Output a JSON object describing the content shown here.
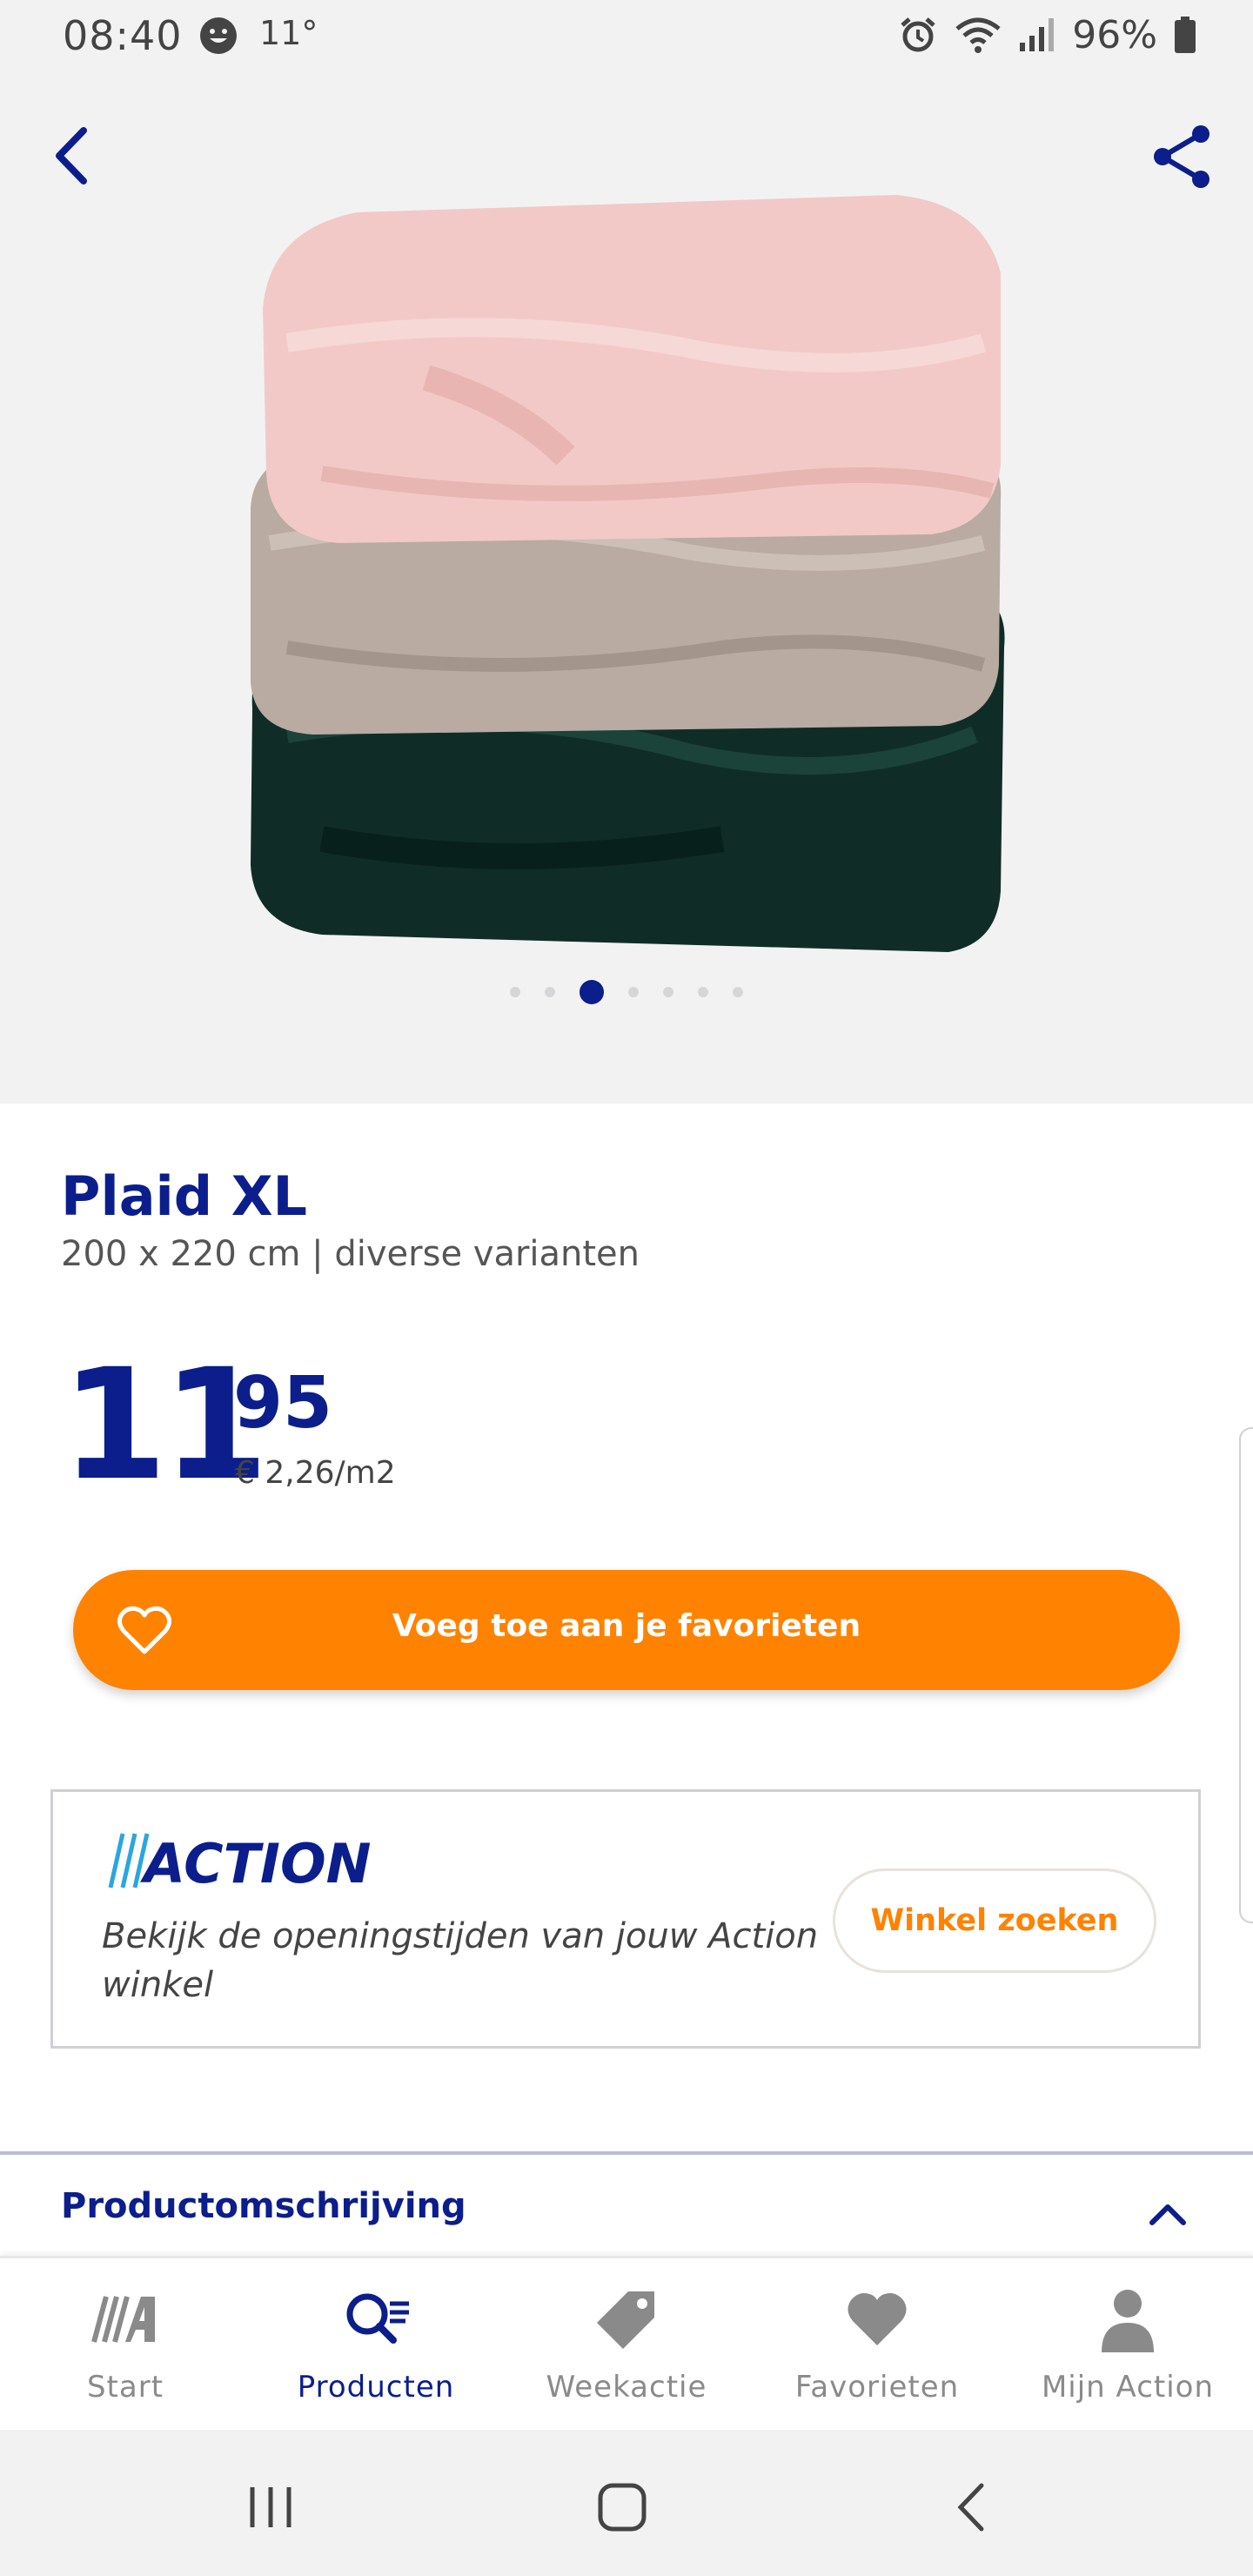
{
  "status": {
    "time": "08:40",
    "temperature": "11°",
    "battery": "96%",
    "icons": [
      "face-icon",
      "alarm-icon",
      "wifi-icon",
      "signal-icon",
      "battery-icon"
    ]
  },
  "hero": {
    "pagination": {
      "count": 7,
      "active_index": 2
    },
    "image": "stacked-plaids-pink-taupe-green"
  },
  "product": {
    "title": "Plaid XL",
    "subtitle": "200 x 220 cm | diverse varianten",
    "price_int": "11",
    "price_dec": "95",
    "price_unit": "€ 2,26/m2"
  },
  "favorite_button": {
    "label": "Voeg toe aan je favorieten"
  },
  "store_card": {
    "logo_text": "ACTION",
    "text": "Bekijk de openingstijden van jouw Action winkel",
    "button_label": "Winkel zoeken"
  },
  "description": {
    "header": "Productomschrijving"
  },
  "bottom_nav": [
    {
      "label": "Start",
      "icon": "action-logo-icon"
    },
    {
      "label": "Producten",
      "icon": "search-list-icon",
      "active": true
    },
    {
      "label": "Weekactie",
      "icon": "tag-icon"
    },
    {
      "label": "Favorieten",
      "icon": "heart-icon"
    },
    {
      "label": "Mijn Action",
      "icon": "person-icon"
    }
  ],
  "colors": {
    "brand_blue": "#0b1e8c",
    "accent_orange": "#ff8200",
    "hero_bg": "#f2f2f3"
  }
}
